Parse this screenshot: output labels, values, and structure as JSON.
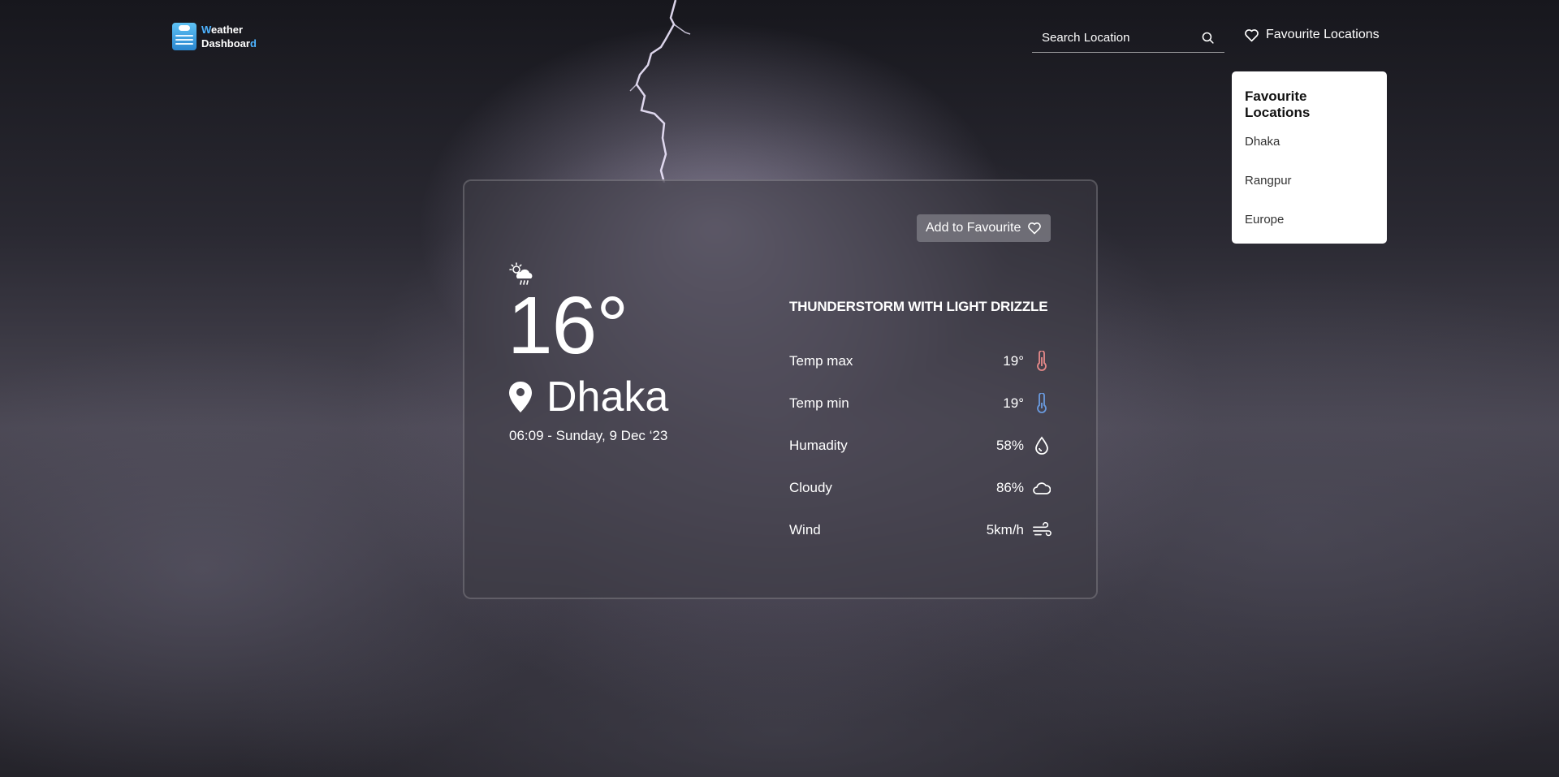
{
  "header": {
    "logo_line1_first": "W",
    "logo_line1_rest": "eather",
    "logo_line2_main": "Dashboar",
    "logo_line2_last": "d",
    "search_placeholder": "Search Location",
    "favourites_link": "Favourite Locations"
  },
  "favourites_dropdown": {
    "title": "Favourite Locations",
    "items": [
      "Dhaka",
      "Rangpur",
      "Europe"
    ]
  },
  "weather": {
    "add_favourite_label": "Add to Favourite",
    "condition_icon": "sun-cloud-rain-icon",
    "temperature": "16°",
    "location": "Dhaka",
    "datetime": "06:09 - Sunday, 9 Dec ‘23",
    "description": "THUNDERSTORM WITH LIGHT DRIZZLE",
    "details": [
      {
        "label": "Temp max",
        "value": "19°",
        "icon": "thermometer-hot-icon",
        "color": "#e88a8a"
      },
      {
        "label": "Temp min",
        "value": "19°",
        "icon": "thermometer-cold-icon",
        "color": "#6a9be0"
      },
      {
        "label": "Humadity",
        "value": "58%",
        "icon": "water-drop-icon",
        "color": "#ffffff"
      },
      {
        "label": "Cloudy",
        "value": "86%",
        "icon": "cloud-icon",
        "color": "#ffffff"
      },
      {
        "label": "Wind",
        "value": "5km/h",
        "icon": "wind-icon",
        "color": "#ffffff"
      }
    ]
  },
  "colors": {
    "accent": "#4db3ff",
    "dropdown_bg": "#ffffff",
    "button_bg": "#78787f"
  }
}
